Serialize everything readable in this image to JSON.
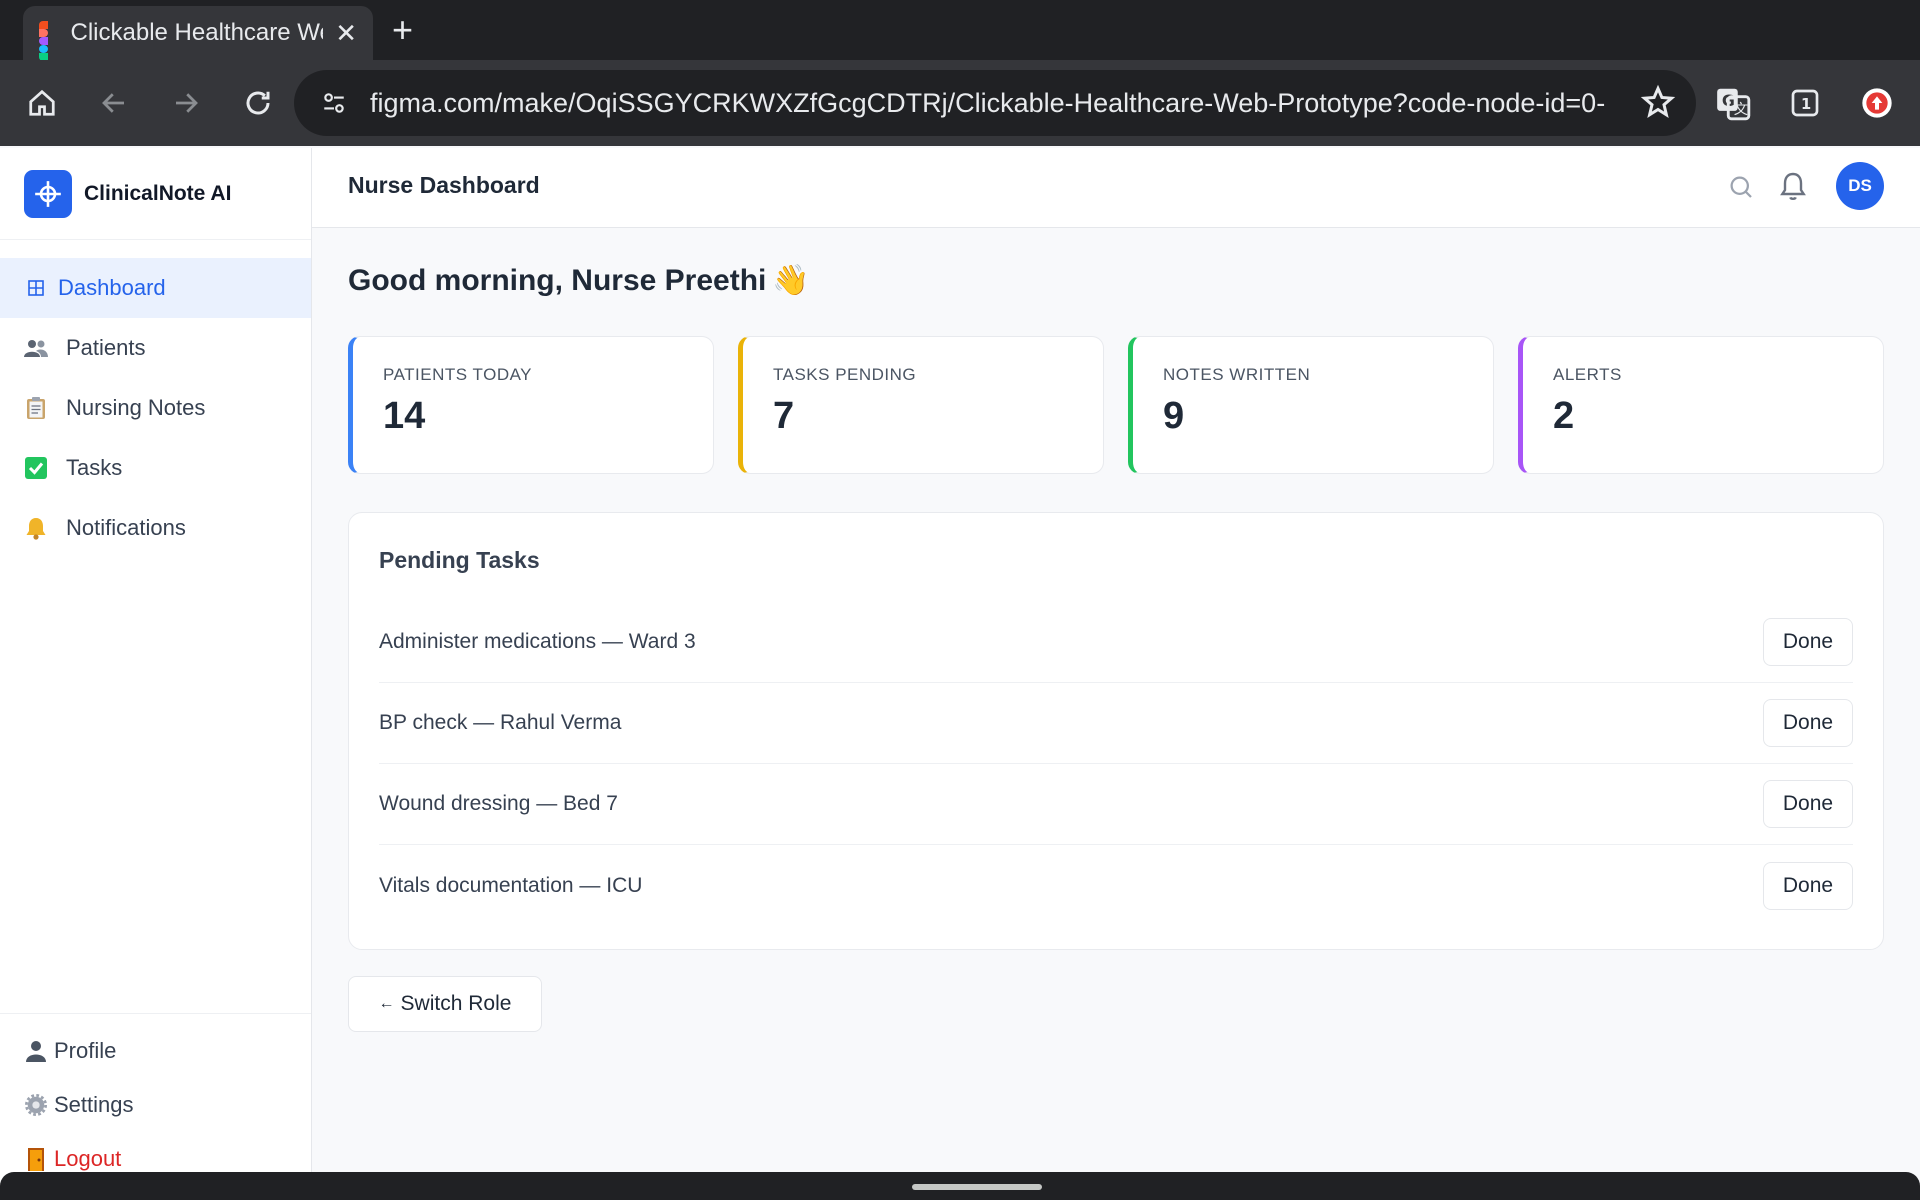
{
  "browser": {
    "tab_title": "Clickable Healthcare We",
    "url": "figma.com/make/OqiSSGYCRKWXZfGcgCDTRj/Clickable-Healthcare-Web-Prototype?code-node-id=0-",
    "tab_count": "1",
    "icons": [
      "figma-favicon",
      "home-icon",
      "back-icon",
      "forward-icon",
      "reload-icon",
      "site-settings-icon",
      "star-icon",
      "translate-icon",
      "tab-count-icon",
      "update-icon"
    ]
  },
  "sidebar": {
    "brand_name": "ClinicalNote AI",
    "items": [
      {
        "label": "Dashboard",
        "icon": "grid-icon",
        "active": true
      },
      {
        "label": "Patients",
        "icon": "people-icon"
      },
      {
        "label": "Nursing Notes",
        "icon": "clipboard-icon"
      },
      {
        "label": "Tasks",
        "icon": "check-box-icon"
      },
      {
        "label": "Notifications",
        "icon": "bell-icon"
      }
    ],
    "bottom": [
      {
        "label": "Profile",
        "icon": "person-icon"
      },
      {
        "label": "Settings",
        "icon": "gear-icon"
      },
      {
        "label": "Logout",
        "icon": "door-icon"
      }
    ]
  },
  "header": {
    "title": "Nurse Dashboard",
    "avatar_initials": "DS"
  },
  "greeting": {
    "text": "Good morning, Nurse Preethi",
    "emoji": "👋"
  },
  "stats": [
    {
      "label": "PATIENTS TODAY",
      "value": "14",
      "color": "#3b82f6"
    },
    {
      "label": "TASKS PENDING",
      "value": "7",
      "color": "#eab308"
    },
    {
      "label": "NOTES WRITTEN",
      "value": "9",
      "color": "#22c55e"
    },
    {
      "label": "ALERTS",
      "value": "2",
      "color": "#a855f7"
    }
  ],
  "tasks": {
    "title": "Pending Tasks",
    "button_label": "Done",
    "items": [
      "Administer medications — Ward 3",
      "BP check — Rahul Verma",
      "Wound dressing — Bed 7",
      "Vitals documentation — ICU"
    ]
  },
  "switch_role": {
    "arrow": "←",
    "label": "Switch Role"
  },
  "colors": {
    "accent": "#2563eb",
    "logout": "#dc2626"
  }
}
